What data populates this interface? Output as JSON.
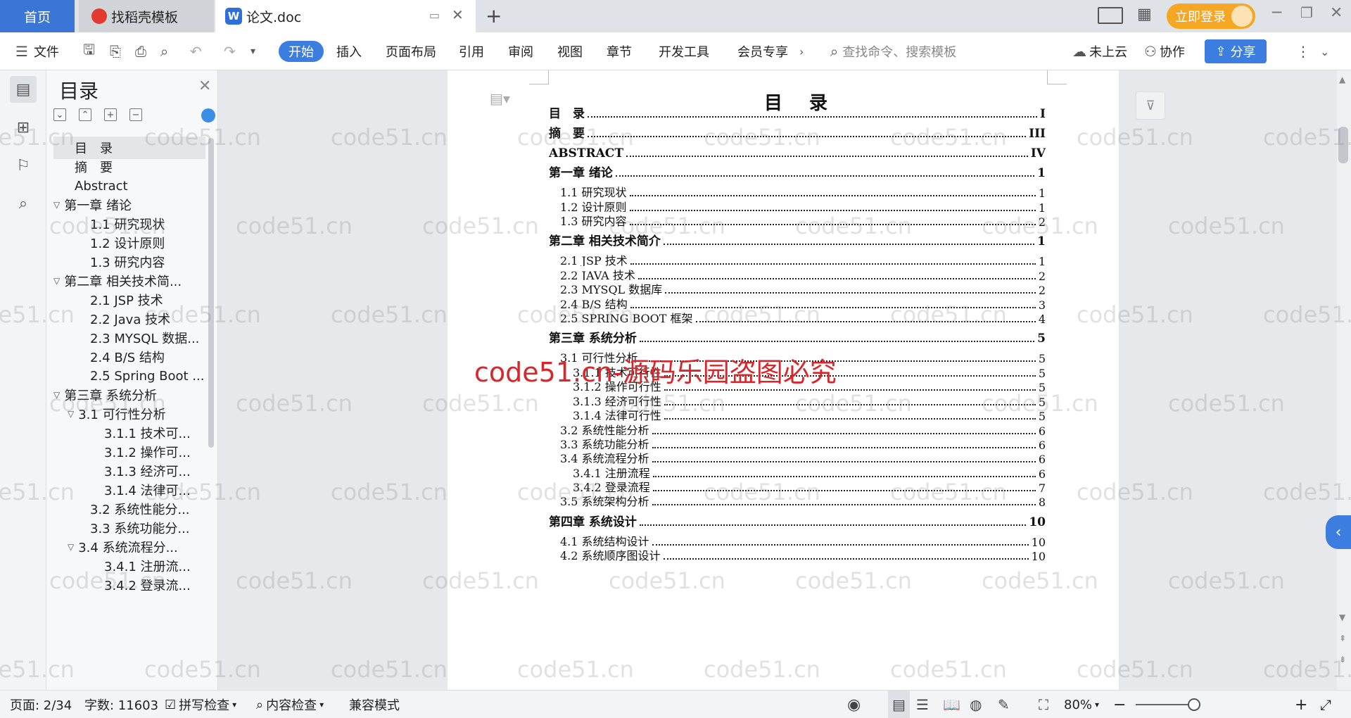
{
  "tabs": {
    "home": "首页",
    "templates": "找稻壳模板",
    "document": "论文.doc",
    "new_tab": "+"
  },
  "header": {
    "login": "立即登录"
  },
  "ribbon": {
    "file": "文件",
    "items": [
      "开始",
      "插入",
      "页面布局",
      "引用",
      "审阅",
      "视图",
      "章节",
      "开发工具",
      "会员专享"
    ],
    "search_placeholder": "查找命令、搜索模板",
    "cloud": "未上云",
    "collab": "协作",
    "share": "分享"
  },
  "toc_panel": {
    "title": "目录",
    "items": [
      {
        "label": "目　录"
      },
      {
        "label": "摘　要"
      },
      {
        "label": "Abstract"
      },
      {
        "label": "第一章 绪论"
      },
      {
        "label": "1.1 研究现状"
      },
      {
        "label": "1.2 设计原则"
      },
      {
        "label": "1.3 研究内容"
      },
      {
        "label": "第二章 相关技术简..."
      },
      {
        "label": "2.1 JSP 技术"
      },
      {
        "label": "2.2 Java 技术"
      },
      {
        "label": "2.3 MYSQL 数据..."
      },
      {
        "label": "2.4 B/S 结构"
      },
      {
        "label": "2.5 Spring Boot ..."
      },
      {
        "label": "第三章 系统分析"
      },
      {
        "label": "3.1 可行性分析"
      },
      {
        "label": "3.1.1 技术可..."
      },
      {
        "label": "3.1.2 操作可..."
      },
      {
        "label": "3.1.3 经济可..."
      },
      {
        "label": "3.1.4 法律可..."
      },
      {
        "label": "3.2 系统性能分..."
      },
      {
        "label": "3.3 系统功能分..."
      },
      {
        "label": "3.4 系统流程分..."
      },
      {
        "label": "3.4.1 注册流..."
      },
      {
        "label": "3.4.2 登录流..."
      }
    ]
  },
  "document": {
    "heading": "目录",
    "entries": [
      {
        "text": "目　录",
        "page": "I"
      },
      {
        "text": "摘　要",
        "page": "III"
      },
      {
        "text": "ABSTRACT",
        "page": "IV"
      },
      {
        "text": "第一章 绪论",
        "page": "1"
      },
      {
        "text": "1.1 研究现状",
        "page": "1"
      },
      {
        "text": "1.2 设计原则",
        "page": "1"
      },
      {
        "text": "1.3 研究内容",
        "page": "2"
      },
      {
        "text": "第二章 相关技术简介",
        "page": "1"
      },
      {
        "text": "2.1 JSP 技术",
        "page": "1"
      },
      {
        "text": "2.2 JAVA 技术",
        "page": "2"
      },
      {
        "text": "2.3 MYSQL 数据库",
        "page": "2"
      },
      {
        "text": "2.4 B/S 结构",
        "page": "3"
      },
      {
        "text": "2.5 SPRING BOOT 框架",
        "page": "4"
      },
      {
        "text": "第三章 系统分析",
        "page": "5"
      },
      {
        "text": "3.1 可行性分析",
        "page": "5"
      },
      {
        "text": "3.1.1 技术可行性",
        "page": "5"
      },
      {
        "text": "3.1.2 操作可行性",
        "page": "5"
      },
      {
        "text": "3.1.3 经济可行性",
        "page": "5"
      },
      {
        "text": "3.1.4 法律可行性",
        "page": "5"
      },
      {
        "text": "3.2 系统性能分析",
        "page": "6"
      },
      {
        "text": "3.3 系统功能分析",
        "page": "6"
      },
      {
        "text": "3.4 系统流程分析",
        "page": "6"
      },
      {
        "text": "3.4.1 注册流程",
        "page": "6"
      },
      {
        "text": "3.4.2 登录流程",
        "page": "7"
      },
      {
        "text": "3.5 系统架构分析",
        "page": "8"
      },
      {
        "text": "第四章 系统设计",
        "page": "10"
      },
      {
        "text": "4.1 系统结构设计",
        "page": "10"
      },
      {
        "text": "4.2 系统顺序图设计",
        "page": "10"
      }
    ]
  },
  "statusbar": {
    "page": "页面: 2/34",
    "words": "字数: 11603",
    "spell": "拼写检查",
    "content_check": "内容检查",
    "compat": "兼容模式",
    "zoom": "80%"
  },
  "watermark": {
    "text": "code51.cn",
    "notice": "code51.cn-源码乐园盗图必究"
  }
}
